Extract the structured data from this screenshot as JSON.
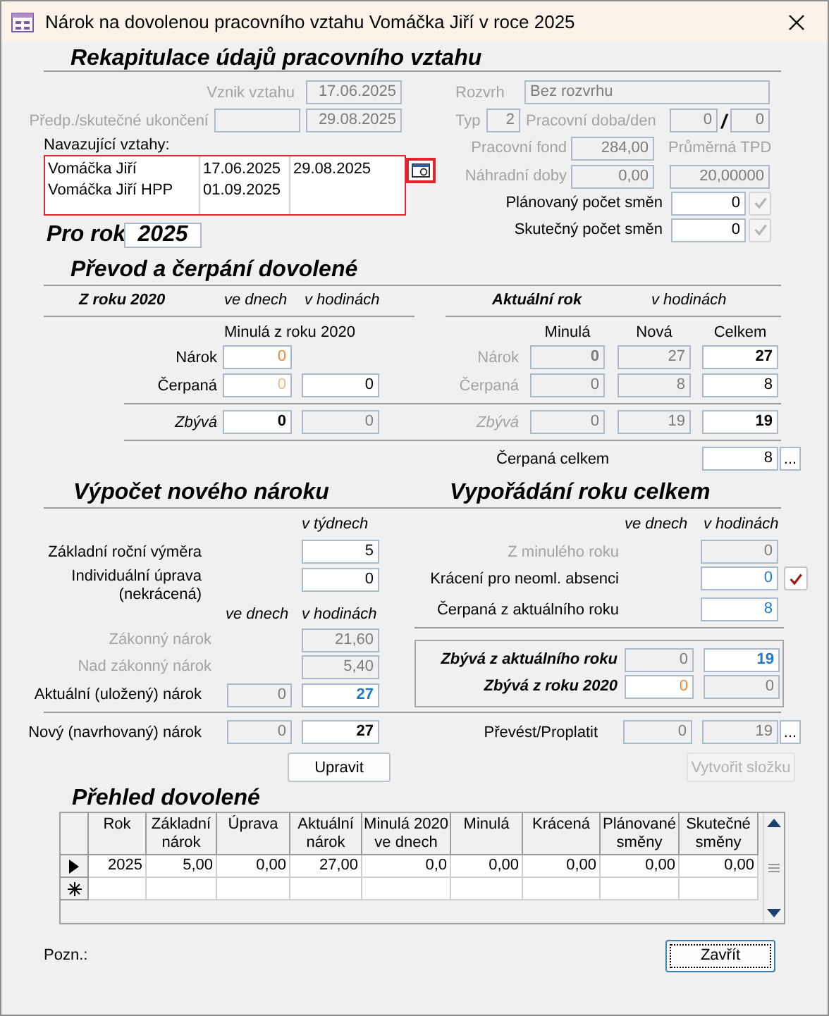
{
  "window": {
    "title": "Nárok na dovolenou pracovního vztahu Vomáčka Jiří v roce 2025"
  },
  "recap": {
    "heading": "Rekapitulace údajů pracovního vztahu",
    "start_label": {
      "text": "Vznik vztahu",
      "disabled": true
    },
    "start": {
      "value": "17.06.2025",
      "disabled": true
    },
    "end_label": {
      "text": "Předp./skutečné ukončení",
      "disabled": true
    },
    "planned_end": {
      "disabled": true
    },
    "end": {
      "value": "29.08.2025",
      "disabled": true
    },
    "related_label": "Navazující vztahy:",
    "related": [
      {
        "name": "Vomáčka Jiří",
        "from": "17.06.2025",
        "to": "29.08.2025"
      },
      {
        "name": "Vomáčka Jiří HPP",
        "from": "01.09.2025"
      }
    ],
    "schedule_label": {
      "text": "Rozvrh",
      "disabled": true
    },
    "schedule": {
      "value": "Bez rozvrhu",
      "disabled": true
    },
    "type_label": {
      "text": "Typ",
      "disabled": true
    },
    "type": {
      "value": "2",
      "disabled": true
    },
    "work_time_label": {
      "text": "Pracovní doba/den",
      "disabled": true
    },
    "work_time": [
      {
        "value": "0",
        "disabled": true
      },
      {
        "value": "0",
        "disabled": true
      }
    ],
    "work_time_separator": "/",
    "fund_label": {
      "text": "Pracovní fond",
      "disabled": true
    },
    "fund": {
      "value": "284,00",
      "disabled": true
    },
    "average_label": {
      "text": "Průměrná TPD",
      "disabled": true
    },
    "substitute_label": {
      "text": "Náhradní doby",
      "disabled": true
    },
    "substitute": {
      "value": "0,00",
      "disabled": true
    },
    "average": {
      "value": "20,00000",
      "disabled": true
    },
    "planned_shifts_label": {
      "text": "Plánovaný počet směn",
      "disabled": false
    },
    "planned_shifts": {
      "value": "0",
      "disabled": false
    },
    "planned_shifts_confirm": {
      "disabled": true
    },
    "actual_shifts_label": {
      "text": "Skutečný počet směn",
      "disabled": false
    },
    "actual_shifts": {
      "value": "0",
      "disabled": false
    },
    "actual_shifts_confirm": {
      "disabled": true
    }
  },
  "year": {
    "label": "Pro rok",
    "value": "2025"
  },
  "transfer": {
    "heading": "Převod a čerpání dovolené",
    "previous": {
      "title": "Z roku 2020",
      "days_header": "ve dnech",
      "hours_header": "v hodinách",
      "subheading": "Minulá z roku 2020"
    },
    "current": {
      "title": "Aktuální rok",
      "hours_header": "v hodinách",
      "columns": [
        "Minulá",
        "Nová",
        "Celkem"
      ]
    },
    "rows": [
      {
        "kind": "entry",
        "previous_label": {
          "text": "Nárok",
          "disabled": false
        },
        "previous": [
          {
            "value": "0",
            "disabled": false,
            "color": "#f0873a"
          }
        ],
        "current_label": {
          "text": "Nárok",
          "disabled": true
        },
        "current": [
          {
            "value": "0",
            "disabled": true,
            "emphasized": true
          },
          {
            "value": "27",
            "disabled": true
          },
          {
            "value": "27",
            "disabled": false,
            "emphasized": true
          }
        ]
      },
      {
        "kind": "entry",
        "previous_label": {
          "text": "Čerpaná",
          "disabled": false
        },
        "previous": [
          {
            "value": "0",
            "disabled": false,
            "color": "#f5b888"
          },
          {
            "value": "0",
            "disabled": false
          }
        ],
        "current_label": {
          "text": "Čerpaná",
          "disabled": true
        },
        "current": [
          {
            "value": "0",
            "disabled": true
          },
          {
            "value": "8",
            "disabled": true
          },
          {
            "value": "8",
            "disabled": false
          }
        ]
      },
      {
        "kind": "remaining",
        "previous_label": {
          "text": "Zbývá",
          "disabled": false
        },
        "previous": [
          {
            "value": "0",
            "disabled": false,
            "emphasized": true
          },
          {
            "value": "0",
            "disabled": true
          }
        ],
        "current_label": {
          "text": "Zbývá",
          "disabled": true
        },
        "current": [
          {
            "value": "0",
            "disabled": true
          },
          {
            "value": "19",
            "disabled": true
          },
          {
            "value": "19",
            "disabled": false,
            "emphasized": true
          }
        ]
      }
    ],
    "total_label": "Čerpaná celkem",
    "total": {
      "value": "8",
      "disabled": false
    },
    "total_button": "..."
  },
  "calculation": {
    "heading": "Výpočet nového nároku",
    "weeks_header": "v týdnech",
    "base_label": "Základní roční výměra",
    "base": {
      "value": "5",
      "disabled": false
    },
    "adjustment_label": "Individuální úprava (nekrácená)",
    "adjustment": {
      "value": "0",
      "disabled": false
    },
    "days_header": "ve dnech",
    "hours_header": "v hodinách",
    "statutory_label": {
      "text": "Zákonný nárok",
      "disabled": true
    },
    "statutory": {
      "value": "21,60",
      "disabled": true
    },
    "extra_label": {
      "text": "Nad zákonný nárok",
      "disabled": true
    },
    "extra": {
      "value": "5,40",
      "disabled": true
    },
    "current_label": "Aktuální (uložený) nárok",
    "current": [
      {
        "value": "0",
        "disabled": true
      },
      {
        "value": "27",
        "disabled": false,
        "color": "#1e7ad0",
        "emphasized": true
      }
    ],
    "proposed_label": "Nový (navrhovaný) nárok",
    "proposed": [
      {
        "value": "0",
        "disabled": true
      },
      {
        "value": "27",
        "disabled": false,
        "emphasized": true
      }
    ],
    "edit_button": {
      "label": "Upravit",
      "disabled": false
    }
  },
  "settlement": {
    "heading": "Vypořádání roku celkem",
    "days_header": "ve dnech",
    "hours_header": "v hodinách",
    "previous_year_label": {
      "text": "Z minulého roku",
      "disabled": true
    },
    "previous_year": {
      "value": "0",
      "disabled": true
    },
    "reduction_label": "Krácení pro neoml. absenci",
    "reduction": {
      "value": "0",
      "disabled": false,
      "color": "#1e7ad0"
    },
    "reduction_confirm": {
      "disabled": false
    },
    "used_label": "Čerpaná z aktuálního roku",
    "used": {
      "value": "8",
      "disabled": false,
      "color": "#1e7ad0"
    },
    "remaining": [
      {
        "label": "Zbývá z aktuálního roku",
        "values": [
          {
            "value": "0",
            "disabled": true
          },
          {
            "value": "19",
            "disabled": false,
            "color": "#1e7ad0",
            "emphasized": true
          }
        ]
      },
      {
        "label": "Zbývá z roku 2020",
        "values": [
          {
            "value": "0",
            "disabled": false,
            "color": "#f0873a"
          },
          {
            "value": "0",
            "disabled": true
          }
        ]
      }
    ],
    "transfer_label": "Převést/Proplatit",
    "transfer": [
      {
        "value": "0",
        "disabled": true
      },
      {
        "value": "19",
        "disabled": true
      }
    ],
    "transfer_button": "...",
    "folder_button": {
      "label": "Vytvořit složku",
      "disabled": true
    }
  },
  "overview": {
    "heading": "Přehled dovolené",
    "columns": [
      "Rok",
      "Základní nárok",
      "Úprava",
      "Aktuální nárok",
      "Minulá 2020 ve dnech",
      "Minulá",
      "Krácená",
      "Plánované směny",
      "Skutečné směny"
    ],
    "rows": [
      {
        "kind": "record",
        "current": true,
        "cells": [
          "2025",
          "5,00",
          "0,00",
          "27,00",
          "0,0",
          "0,00",
          "0,00",
          "0,00",
          "0,00"
        ]
      },
      {
        "kind": "new",
        "current": false
      }
    ]
  },
  "note_label": "Pozn.:",
  "close_button": {
    "label": "Zavřít",
    "focused": true
  }
}
